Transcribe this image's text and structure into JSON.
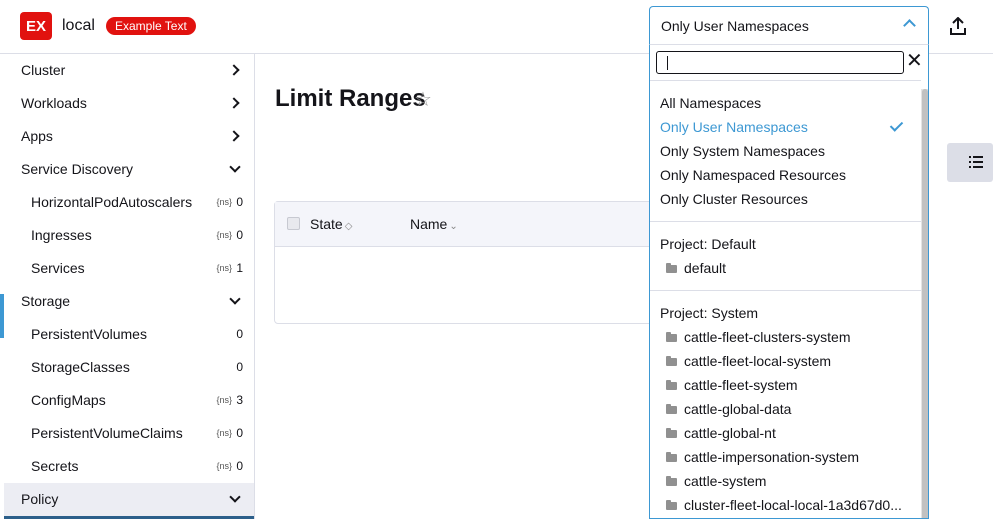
{
  "header": {
    "logo_text": "EX",
    "cluster_name": "local",
    "badge_text": "Example Text",
    "namespace_selected": "Only User Namespaces",
    "upload_icon": "upload-icon"
  },
  "sidebar": {
    "items": [
      {
        "label": "Cluster",
        "type": "group",
        "state": "collapsed"
      },
      {
        "label": "Workloads",
        "type": "group",
        "state": "collapsed"
      },
      {
        "label": "Apps",
        "type": "group",
        "state": "collapsed"
      },
      {
        "label": "Service Discovery",
        "type": "group",
        "state": "expanded"
      },
      {
        "label": "HorizontalPodAutoscalers",
        "type": "child",
        "count": "0",
        "namespaced": true
      },
      {
        "label": "Ingresses",
        "type": "child",
        "count": "0",
        "namespaced": true
      },
      {
        "label": "Services",
        "type": "child",
        "count": "1",
        "namespaced": true
      },
      {
        "label": "Storage",
        "type": "group",
        "state": "expanded"
      },
      {
        "label": "PersistentVolumes",
        "type": "child",
        "count": "0",
        "namespaced": false
      },
      {
        "label": "StorageClasses",
        "type": "child",
        "count": "0",
        "namespaced": false
      },
      {
        "label": "ConfigMaps",
        "type": "child",
        "count": "3",
        "namespaced": true
      },
      {
        "label": "PersistentVolumeClaims",
        "type": "child",
        "count": "0",
        "namespaced": true
      },
      {
        "label": "Secrets",
        "type": "child",
        "count": "0",
        "namespaced": true
      },
      {
        "label": "Policy",
        "type": "group",
        "state": "expanded"
      }
    ],
    "namespaced_chip": "{ns}"
  },
  "main": {
    "title": "Limit Ranges",
    "columns": [
      "State",
      "Name"
    ]
  },
  "namespace_menu": {
    "search_value": "",
    "options": [
      {
        "label": "All Namespaces",
        "selected": false
      },
      {
        "label": "Only User Namespaces",
        "selected": true
      },
      {
        "label": "Only System Namespaces",
        "selected": false
      },
      {
        "label": "Only Namespaced Resources",
        "selected": false
      },
      {
        "label": "Only Cluster Resources",
        "selected": false
      }
    ],
    "groups": [
      {
        "label": "Project: Default",
        "namespaces": [
          "default"
        ]
      },
      {
        "label": "Project: System",
        "namespaces": [
          "cattle-fleet-clusters-system",
          "cattle-fleet-local-system",
          "cattle-fleet-system",
          "cattle-global-data",
          "cattle-global-nt",
          "cattle-impersonation-system",
          "cattle-system",
          "cluster-fleet-local-local-1a3d67d0..."
        ]
      }
    ]
  },
  "colors": {
    "brand": "#e1120f",
    "accent": "#3d98d3",
    "text": "#141419",
    "border": "#dcdee7"
  }
}
